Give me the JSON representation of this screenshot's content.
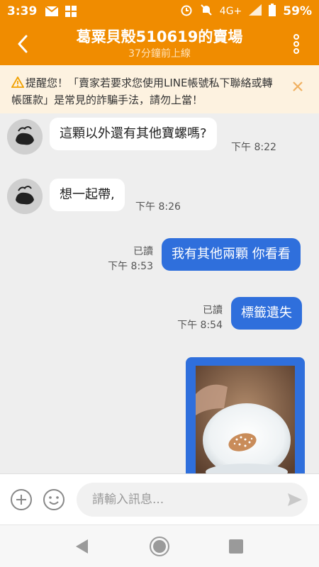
{
  "status_bar": {
    "time": "3:39",
    "network": "4G+",
    "battery": "59%"
  },
  "header": {
    "title": "葛粟貝殼510619的賣場",
    "subtitle": "37分鐘前上線"
  },
  "warning": {
    "text": "提醒您！「賣家若要求您使用LINE帳號私下聯絡或轉帳匯款」是常見的詐騙手法，請勿上當！"
  },
  "messages": [
    {
      "direction": "in",
      "text": "這顆以外還有其他寶螺嗎?",
      "time": "下午 8:22"
    },
    {
      "direction": "in",
      "text": "想一起帶,",
      "time": "下午 8:26"
    },
    {
      "direction": "out",
      "text": "我有其他兩顆 你看看",
      "read": "已讀",
      "time": "下午 8:53"
    },
    {
      "direction": "out",
      "text": "標籤遺失",
      "read": "已讀",
      "time": "下午 8:54"
    }
  ],
  "input": {
    "placeholder": "請輸入訊息..."
  },
  "colors": {
    "brand": "#f08c00",
    "outgoing_bubble": "#2f6fdc",
    "warning_bg": "#fdf2e0"
  }
}
